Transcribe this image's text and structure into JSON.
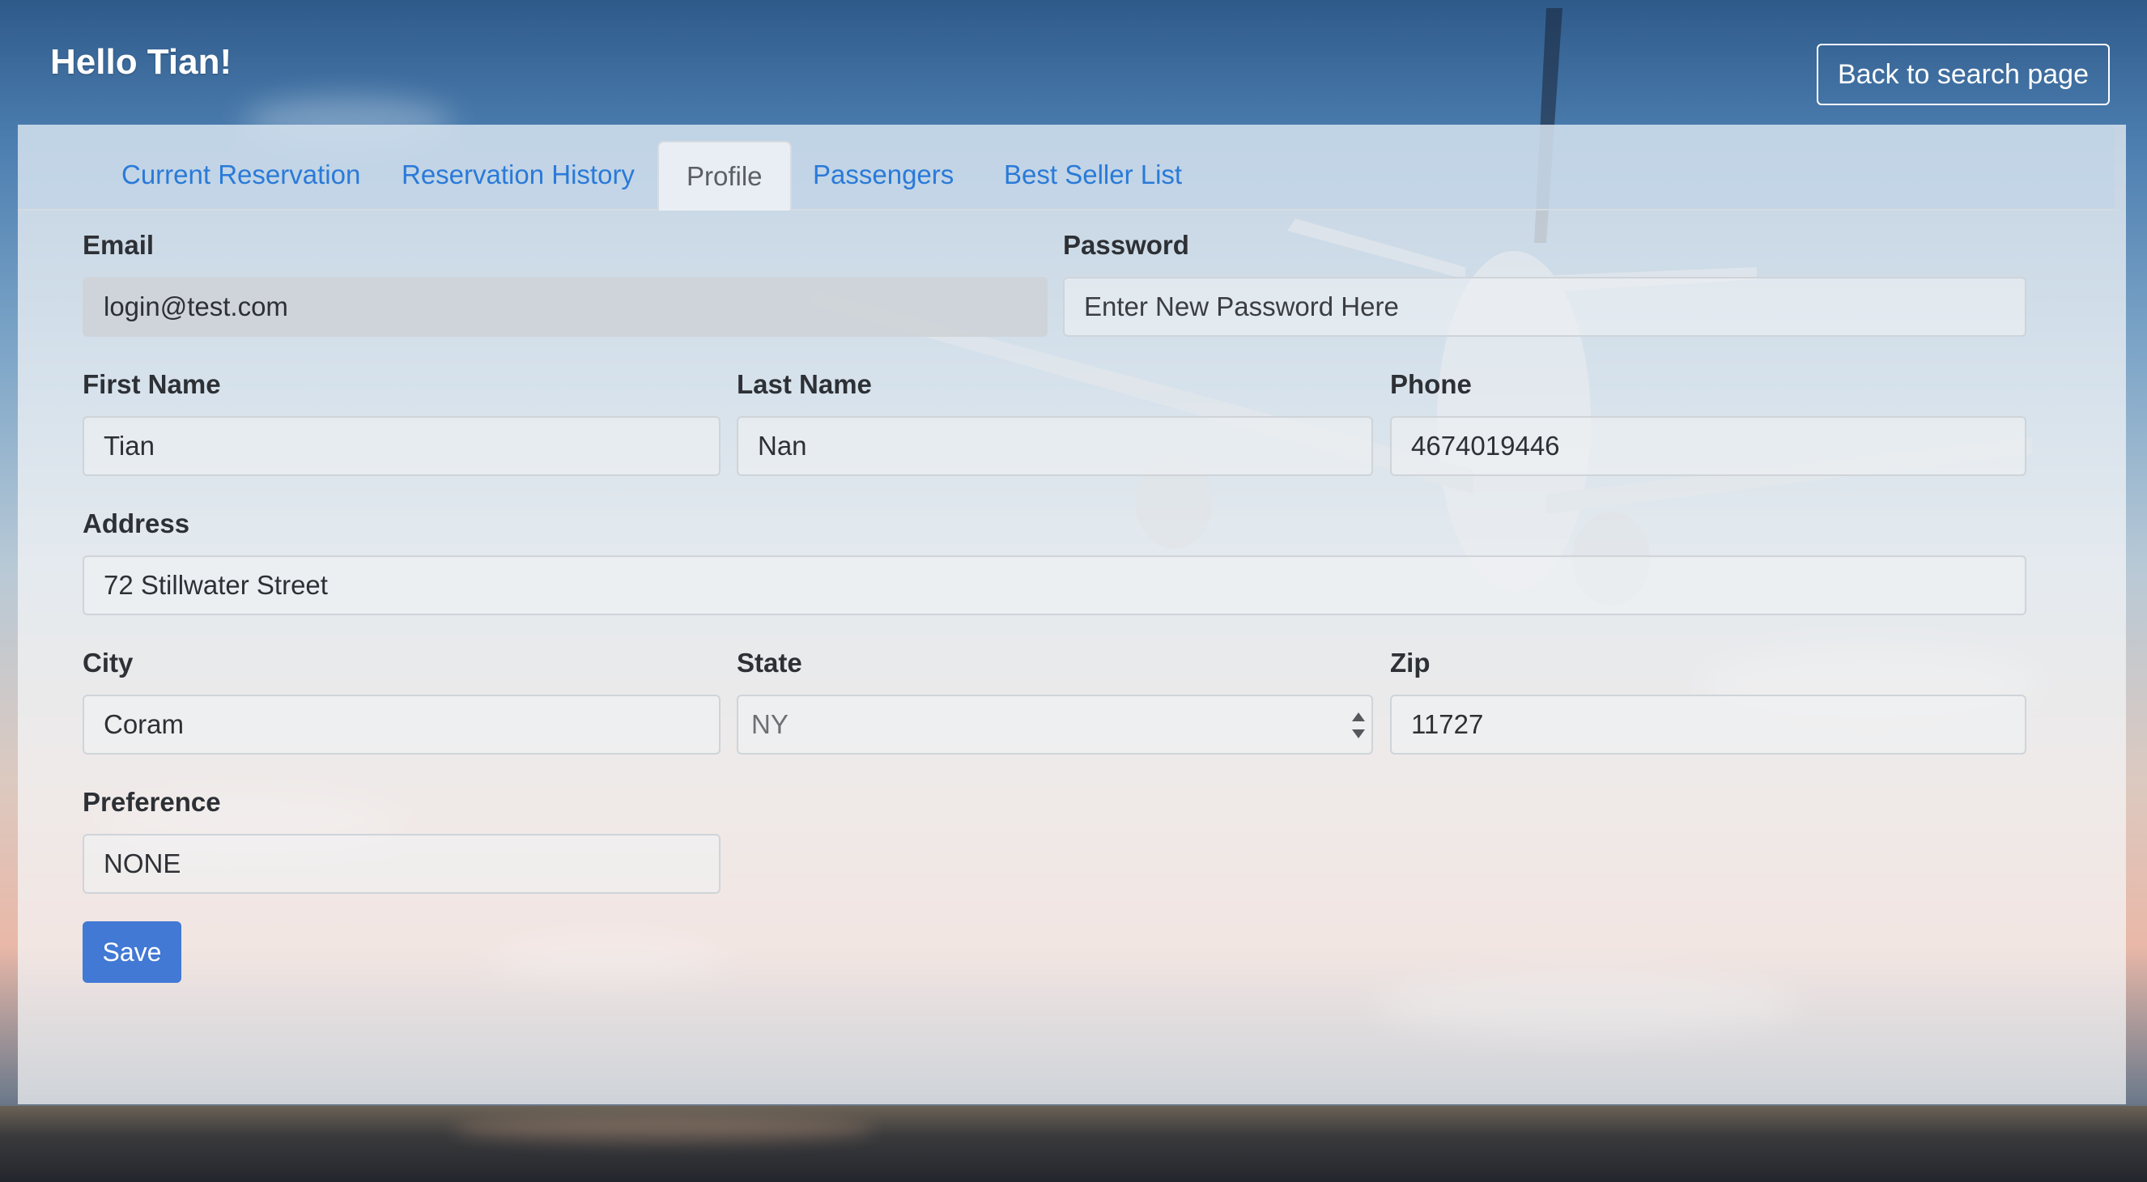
{
  "header": {
    "greeting": "Hello Tian!",
    "back_button": "Back to search page"
  },
  "tabs": [
    {
      "label": "Current Reservation",
      "active": false
    },
    {
      "label": "Reservation History",
      "active": false
    },
    {
      "label": "Profile",
      "active": true
    },
    {
      "label": "Passengers",
      "active": false
    },
    {
      "label": "Best Seller List",
      "active": false
    }
  ],
  "form": {
    "email": {
      "label": "Email",
      "value": "login@test.com",
      "readonly": true
    },
    "password": {
      "label": "Password",
      "value": "",
      "placeholder": "Enter New Password Here"
    },
    "first_name": {
      "label": "First Name",
      "value": "Tian"
    },
    "last_name": {
      "label": "Last Name",
      "value": "Nan"
    },
    "phone": {
      "label": "Phone",
      "value": "4674019446"
    },
    "address": {
      "label": "Address",
      "value": "72 Stillwater Street"
    },
    "city": {
      "label": "City",
      "value": "Coram"
    },
    "state": {
      "label": "State",
      "value": "NY"
    },
    "zip": {
      "label": "Zip",
      "value": "11727"
    },
    "preference": {
      "label": "Preference",
      "value": "NONE"
    },
    "save_label": "Save"
  },
  "colors": {
    "accent": "#4179d4",
    "tab_link": "#2a7ad8"
  }
}
